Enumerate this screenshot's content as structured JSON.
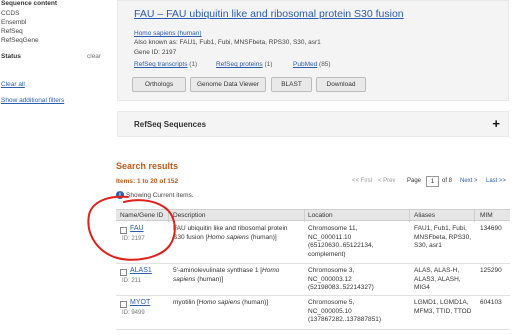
{
  "sidebar": {
    "sequence_content_heading": "Sequence content",
    "sequence_content_items": [
      "CCDS",
      "Ensembl",
      "RefSeq",
      "RefSeqGene"
    ],
    "status_heading": "Status",
    "clear_label": "clear",
    "clear_all": "Clear all",
    "show_filters": "Show additional filters"
  },
  "gene": {
    "title": "FAU – FAU ubiquitin like and ribosomal protein S30 fusion",
    "species": "Homo sapiens (human)",
    "also_known_as": "Also known as: FAU1, Fub1, Fubi, MNSFbeta, RPS30, S30, asr1",
    "gene_id": "Gene ID: 2197",
    "refseq_transcripts": "RefSeq transcripts",
    "refseq_transcripts_count": "(1)",
    "refseq_proteins": "RefSeq proteins",
    "refseq_proteins_count": "(1)",
    "pubmed": "PubMed",
    "pubmed_count": "(85)",
    "buttons": [
      "Orthologs",
      "Genome Data Viewer",
      "BLAST",
      "Download"
    ]
  },
  "refseq_section": {
    "title": "RefSeq Sequences",
    "toggle": "+"
  },
  "results": {
    "title": "Search results",
    "items": "Items: 1 to 20 of 152",
    "pager": {
      "first": "<< First",
      "prev": "< Prev",
      "page_label": "Page",
      "page_value": "1",
      "of": "of 8",
      "next": "Next >",
      "last": "Last >>"
    },
    "showing": "Showing Current items.",
    "info_icon": "i",
    "columns": [
      "Name/Gene ID",
      "Description",
      "Location",
      "Aliases",
      "MIM"
    ],
    "rows": [
      {
        "name": "FAU",
        "id": "ID: 2197",
        "desc": [
          "FAU ubiquitin like and ribosomal protein",
          "S30 fusion [",
          "Homo sapiens",
          " (human)]"
        ],
        "location": [
          "Chromosome 11,",
          "NC_000011.10",
          "(65120630..65122134,",
          "complement)"
        ],
        "aliases": [
          "FAU1, Fub1, Fubi,",
          "MNSFbeta, RPS30,",
          "S30, asr1"
        ],
        "mim": "134690"
      },
      {
        "name": "ALAS1",
        "id": "ID: 211",
        "desc": [
          "5'-aminolevulinate synthase 1 [",
          "Homo",
          "sapiens",
          " (human)]"
        ],
        "location": [
          "Chromosome 3,",
          "NC_000003.12",
          "(52198083..52214327)"
        ],
        "aliases": [
          "ALAS, ALAS-H,",
          "ALAS3, ALASH,",
          "MIG4"
        ],
        "mim": "125290"
      },
      {
        "name": "MYOT",
        "id": "ID: 9499",
        "desc": [
          "myotilin [",
          "Homo sapiens",
          " (human)]"
        ],
        "location": [
          "Chromosome 5,",
          "NC_000005.10",
          "(137867282..137887851)"
        ],
        "aliases": [
          "LGMD1, LGMD1A,",
          "MFM3, TTID, TTOD"
        ],
        "mim": "604103"
      }
    ]
  },
  "colors": {
    "link": "#2a5db0",
    "results_accent": "#c05a1a",
    "annotation": "#e0201b"
  }
}
